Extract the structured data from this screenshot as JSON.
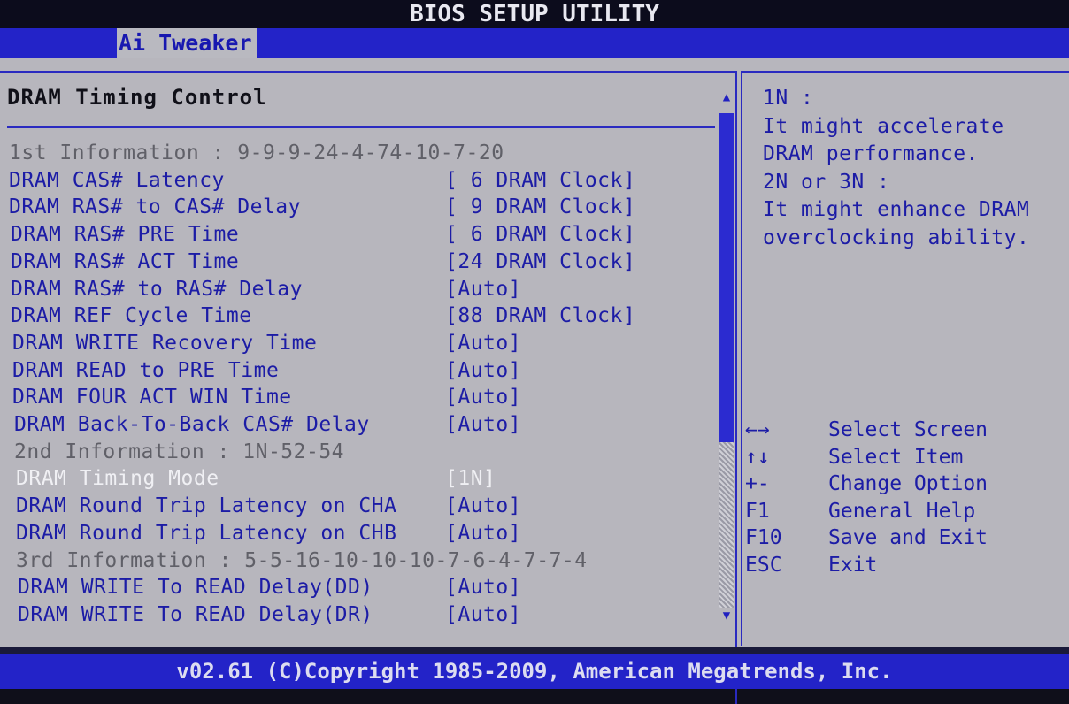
{
  "window": {
    "title": "BIOS SETUP UTILITY"
  },
  "menu": {
    "active_tab": "Ai Tweaker"
  },
  "section": {
    "title": "DRAM Timing Control"
  },
  "rows": [
    {
      "label": "1st Information : 9-9-9-24-4-74-10-7-20",
      "value": "",
      "style": "gray"
    },
    {
      "label": "DRAM CAS# Latency",
      "value": "[ 6 DRAM Clock]",
      "style": "blue"
    },
    {
      "label": "DRAM RAS# to CAS# Delay",
      "value": "[ 9 DRAM Clock]",
      "style": "blue"
    },
    {
      "label": "DRAM RAS# PRE Time",
      "value": "[ 6 DRAM Clock]",
      "style": "blue"
    },
    {
      "label": "DRAM RAS# ACT Time",
      "value": "[24 DRAM Clock]",
      "style": "blue"
    },
    {
      "label": "DRAM RAS# to RAS# Delay",
      "value": "[Auto]",
      "style": "blue"
    },
    {
      "label": "DRAM REF Cycle Time",
      "value": "[88 DRAM Clock]",
      "style": "blue"
    },
    {
      "label": "DRAM WRITE Recovery Time",
      "value": "[Auto]",
      "style": "blue"
    },
    {
      "label": "DRAM READ to PRE Time",
      "value": "[Auto]",
      "style": "blue"
    },
    {
      "label": "DRAM FOUR ACT WIN Time",
      "value": "[Auto]",
      "style": "blue"
    },
    {
      "label": "DRAM Back-To-Back CAS# Delay",
      "value": "[Auto]",
      "style": "blue"
    },
    {
      "label": "2nd Information : 1N-52-54",
      "value": "",
      "style": "gray"
    },
    {
      "label": "DRAM Timing Mode",
      "value": "[1N]",
      "style": "white"
    },
    {
      "label": "DRAM Round Trip Latency on CHA",
      "value": "[Auto]",
      "style": "blue"
    },
    {
      "label": "DRAM Round Trip Latency on CHB",
      "value": "[Auto]",
      "style": "blue"
    },
    {
      "label": "3rd Information : 5-5-16-10-10-10-7-6-4-7-7-4",
      "value": "",
      "style": "gray"
    },
    {
      "label": "DRAM WRITE To READ Delay(DD)",
      "value": "[Auto]",
      "style": "blue"
    },
    {
      "label": "DRAM WRITE To READ Delay(DR)",
      "value": "[Auto]",
      "style": "blue"
    }
  ],
  "help": {
    "lines": [
      "1N :",
      "It might accelerate",
      "DRAM performance.",
      "2N or 3N :",
      "It might enhance DRAM",
      "overclocking ability."
    ]
  },
  "keys": [
    {
      "key": "←→",
      "desc": "Select Screen",
      "icon": "left-right-arrows-icon"
    },
    {
      "key": "↑↓",
      "desc": "Select Item",
      "icon": "up-down-arrows-icon"
    },
    {
      "key": "+-",
      "desc": "Change Option",
      "icon": ""
    },
    {
      "key": "F1",
      "desc": "General Help",
      "icon": ""
    },
    {
      "key": "F10",
      "desc": "Save and Exit",
      "icon": ""
    },
    {
      "key": "ESC",
      "desc": "Exit",
      "icon": ""
    }
  ],
  "scroll": {
    "up_arrow": "▲",
    "down_arrow": "▼",
    "position": 0.0,
    "visible_fraction": 0.66
  },
  "footer": {
    "text": "v02.61 (C)Copyright 1985-2009, American Megatrends, Inc."
  },
  "colors": {
    "menubar": "#2323c8",
    "panel": "#b7b6bd",
    "item_text": "#1c1ca6",
    "info_text": "#606068",
    "selected_text": "#f0f0f4"
  }
}
